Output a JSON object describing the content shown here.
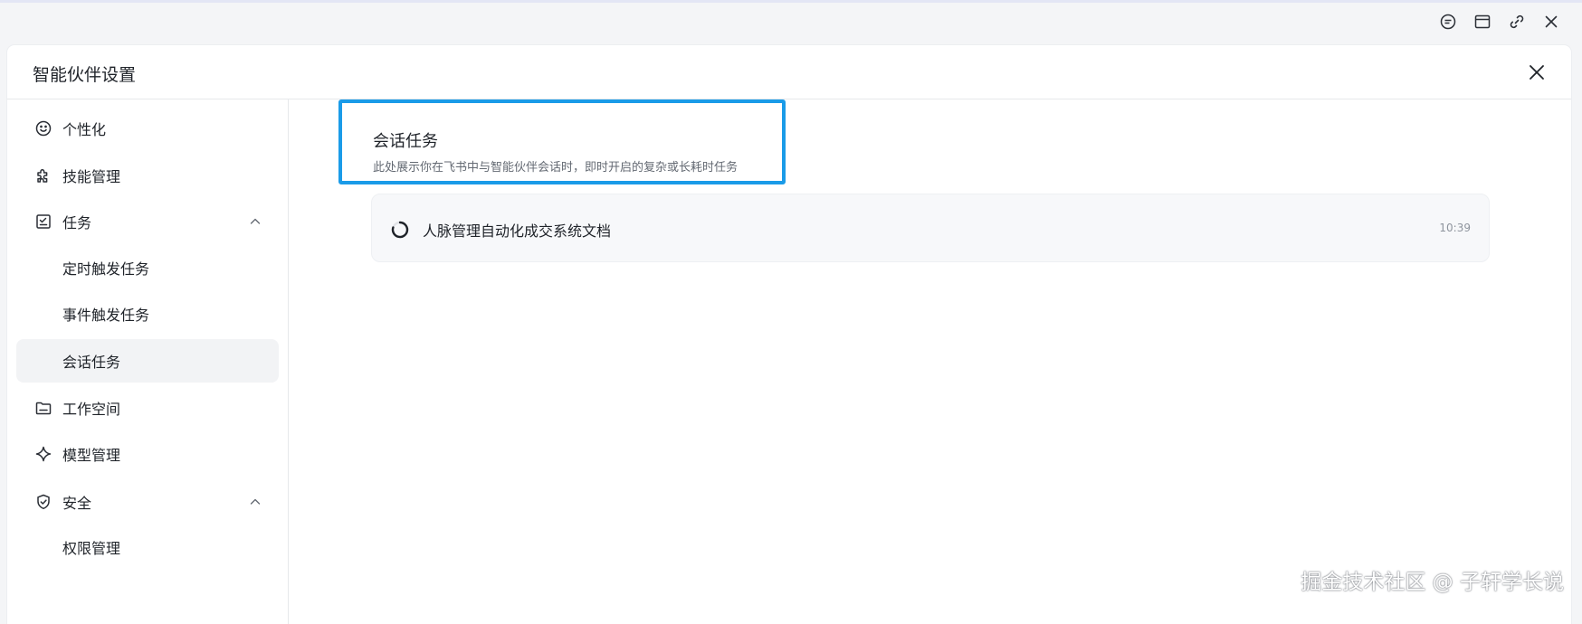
{
  "window": {
    "toolbar_icons": [
      "chat-icon",
      "window-icon",
      "link-icon",
      "close-icon"
    ]
  },
  "panel": {
    "title": "智能伙伴设置",
    "close_icon": "close-icon"
  },
  "sidebar": {
    "items": [
      {
        "label": "个性化",
        "icon": "smile-icon"
      },
      {
        "label": "技能管理",
        "icon": "puzzle-icon"
      },
      {
        "label": "任务",
        "icon": "checklist-icon",
        "expanded": true
      },
      {
        "label": "定时触发任务"
      },
      {
        "label": "事件触发任务"
      },
      {
        "label": "会话任务",
        "active": true
      },
      {
        "label": "工作空间",
        "icon": "folder-icon"
      },
      {
        "label": "模型管理",
        "icon": "sparkle-icon"
      },
      {
        "label": "安全",
        "icon": "shield-icon",
        "expanded": true
      },
      {
        "label": "权限管理"
      }
    ]
  },
  "main": {
    "section_title": "会话任务",
    "section_desc": "此处展示你在飞书中与智能伙伴会话时，即时开启的复杂或长耗时任务",
    "tasks": [
      {
        "title": "人脉管理自动化成交系统文档",
        "time": "10:39",
        "status": "loading"
      }
    ]
  },
  "watermark": "掘金技术社区 @ 子轩学长说",
  "colors": {
    "accent": "#1a9be8",
    "active_bg": "#f2f3f5"
  }
}
